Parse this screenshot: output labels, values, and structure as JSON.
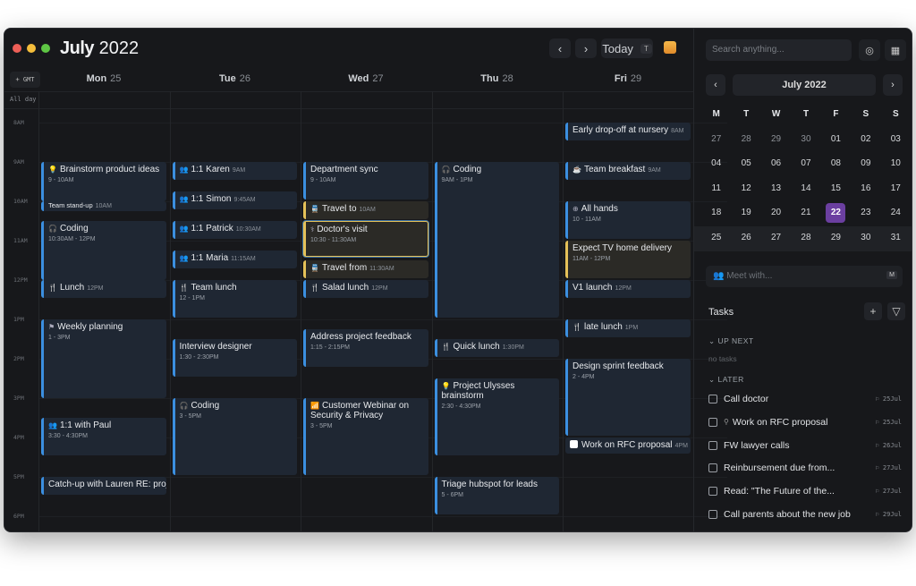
{
  "header": {
    "month": "July",
    "year": "2022",
    "today_label": "Today",
    "today_key": "T",
    "prev_icon": "chevron-left-icon",
    "next_icon": "chevron-right-icon"
  },
  "gutter": {
    "gmt_label": "+ GMT",
    "allday_label": "All day",
    "hours": [
      {
        "h": 8,
        "label": "8AM"
      },
      {
        "h": 9,
        "label": "9AM"
      },
      {
        "h": 10,
        "label": "10AM"
      },
      {
        "h": 11,
        "label": "11AM"
      },
      {
        "h": 12,
        "label": "12PM"
      },
      {
        "h": 13,
        "label": "1PM"
      },
      {
        "h": 14,
        "label": "2PM"
      },
      {
        "h": 15,
        "label": "3PM"
      },
      {
        "h": 16,
        "label": "4PM"
      },
      {
        "h": 17,
        "label": "5PM"
      },
      {
        "h": 18,
        "label": "6PM"
      }
    ]
  },
  "days": [
    {
      "name": "Mon",
      "num": "25",
      "events": [
        {
          "title": "Brainstorm product ideas",
          "icon": "💡",
          "sub": "9 - 10AM",
          "start": 9,
          "end": 10
        },
        {
          "title": "Team stand-up",
          "tm": "10AM",
          "start": 10,
          "end": 10.25,
          "tiny": true
        },
        {
          "title": "Coding",
          "icon": "🎧",
          "sub": "10:30AM - 12PM",
          "start": 10.5,
          "end": 12
        },
        {
          "title": "Lunch",
          "icon": "🍴",
          "tm": "12PM",
          "start": 12,
          "end": 12.45
        },
        {
          "title": "Weekly planning",
          "icon": "⚑",
          "sub": "1 - 3PM",
          "start": 13,
          "end": 15
        },
        {
          "title": "1:1 with Paul",
          "icon": "👥",
          "sub": "3:30 - 4:30PM",
          "start": 15.5,
          "end": 16.45
        },
        {
          "title": "Catch-up with Lauren RE: project",
          "start": 17,
          "end": 17.45
        }
      ]
    },
    {
      "name": "Tue",
      "num": "26",
      "events": [
        {
          "title": "1:1 Karen",
          "icon": "👥",
          "tm": "9AM",
          "start": 9,
          "end": 9.45
        },
        {
          "title": "1:1 Simon",
          "icon": "👥",
          "tm": "9:45AM",
          "start": 9.75,
          "end": 10.2
        },
        {
          "title": "1:1 Patrick",
          "icon": "👥",
          "tm": "10:30AM",
          "start": 10.5,
          "end": 10.95
        },
        {
          "title": "1:1 Maria",
          "icon": "👥",
          "tm": "11:15AM",
          "start": 11.25,
          "end": 11.7
        },
        {
          "title": "Team lunch",
          "icon": "🍴",
          "sub": "12 - 1PM",
          "start": 12,
          "end": 12.95
        },
        {
          "title": "Interview designer",
          "sub": "1:30 - 2:30PM",
          "start": 13.5,
          "end": 14.45
        },
        {
          "title": "Coding",
          "icon": "🎧",
          "sub": "3 - 5PM",
          "start": 15,
          "end": 16.95
        }
      ]
    },
    {
      "name": "Wed",
      "num": "27",
      "events": [
        {
          "title": "Department sync",
          "sub": "9 - 10AM",
          "start": 9,
          "end": 9.95
        },
        {
          "title": "Travel to",
          "icon": "🚆",
          "tm": "10AM",
          "start": 10,
          "end": 10.45,
          "yellow": true
        },
        {
          "title": "Doctor's visit",
          "icon": "⚕",
          "sub": "10:30 - 11:30AM",
          "start": 10.5,
          "end": 11.42,
          "yellow": true,
          "selected": true
        },
        {
          "title": "Travel from",
          "icon": "🚆",
          "tm": "11:30AM",
          "start": 11.5,
          "end": 11.95,
          "yellow": true
        },
        {
          "title": "Salad lunch",
          "icon": "🍴",
          "tm": "12PM",
          "start": 12,
          "end": 12.45
        },
        {
          "title": "Address project feedback",
          "sub": "1:15 - 2:15PM",
          "start": 13.25,
          "end": 14.2
        },
        {
          "title": "Customer Webinar on Security & Privacy",
          "icon": "📶",
          "sub": "3 - 5PM",
          "start": 15,
          "end": 16.95
        }
      ]
    },
    {
      "name": "Thu",
      "num": "28",
      "events": [
        {
          "title": "Coding",
          "icon": "🎧",
          "sub": "9AM - 1PM",
          "start": 9,
          "end": 12.95
        },
        {
          "title": "Quick lunch",
          "icon": "🍴",
          "tm": "1:30PM",
          "start": 13.5,
          "end": 13.95
        },
        {
          "title": "Project Ulysses brainstorm",
          "icon": "💡",
          "sub": "2:30 - 4:30PM",
          "start": 14.5,
          "end": 16.45
        },
        {
          "title": "Triage hubspot for leads",
          "sub": "5 - 6PM",
          "start": 17,
          "end": 17.95
        }
      ]
    },
    {
      "name": "Fri",
      "num": "29",
      "events": [
        {
          "title": "Early drop-off at nursery",
          "tm": "8AM",
          "start": 8,
          "end": 8.45
        },
        {
          "title": "Team breakfast",
          "icon": "☕",
          "tm": "9AM",
          "start": 9,
          "end": 9.45
        },
        {
          "title": "All hands",
          "icon": "⊕",
          "sub": "10 - 11AM",
          "start": 10,
          "end": 10.95
        },
        {
          "title": "Expect TV home delivery",
          "sub": "11AM - 12PM",
          "start": 11,
          "end": 11.95,
          "yellow": true
        },
        {
          "title": "V1 launch",
          "tm": "12PM",
          "start": 12,
          "end": 12.45
        },
        {
          "title": "late lunch",
          "icon": "🍴",
          "tm": "1PM",
          "start": 13,
          "end": 13.45
        },
        {
          "title": "Design sprint feedback",
          "sub": "2 - 4PM",
          "start": 14,
          "end": 15.95
        },
        {
          "title": "Work on RFC proposal",
          "tm": "4PM",
          "start": 16,
          "end": 16.4,
          "task": true
        }
      ]
    }
  ],
  "sidebar": {
    "search_placeholder": "Search anything...",
    "mini_cal": {
      "title": "July 2022",
      "weekdays": [
        "M",
        "T",
        "W",
        "T",
        "F",
        "S",
        "S"
      ],
      "days": [
        [
          "27",
          true
        ],
        [
          "28",
          true
        ],
        [
          "29",
          true
        ],
        [
          "30",
          true
        ],
        [
          "01"
        ],
        [
          "02"
        ],
        [
          "03"
        ],
        [
          "04"
        ],
        [
          "05"
        ],
        [
          "06"
        ],
        [
          "07"
        ],
        [
          "08"
        ],
        [
          "09"
        ],
        [
          "10"
        ],
        [
          "11"
        ],
        [
          "12"
        ],
        [
          "13"
        ],
        [
          "14"
        ],
        [
          "15"
        ],
        [
          "16"
        ],
        [
          "17"
        ],
        [
          "18"
        ],
        [
          "19"
        ],
        [
          "20"
        ],
        [
          "21"
        ],
        [
          "22",
          false,
          true
        ],
        [
          "23"
        ],
        [
          "24"
        ],
        [
          "25"
        ],
        [
          "26"
        ],
        [
          "27"
        ],
        [
          "28"
        ],
        [
          "29"
        ],
        [
          "30"
        ],
        [
          "31"
        ]
      ]
    },
    "meet_placeholder": "Meet with...",
    "meet_key": "M",
    "tasks_title": "Tasks",
    "up_next": "UP NEXT",
    "no_tasks": "no tasks",
    "later": "LATER",
    "tasks": [
      {
        "label": "Call doctor",
        "due": "25Jul"
      },
      {
        "label": "Work on RFC proposal",
        "due": "25Jul",
        "pinned": true
      },
      {
        "label": "FW lawyer calls",
        "due": "26Jul"
      },
      {
        "label": "Reinbursement due from...",
        "due": "27Jul"
      },
      {
        "label": "Read: \"The Future of the...",
        "due": "27Jul"
      },
      {
        "label": "Call parents about the new job",
        "due": "29Jul"
      }
    ]
  },
  "colors": {
    "accent_blue": "#3b8fe0",
    "accent_yellow": "#e5c158",
    "today_purple": "#6b3fa0"
  }
}
